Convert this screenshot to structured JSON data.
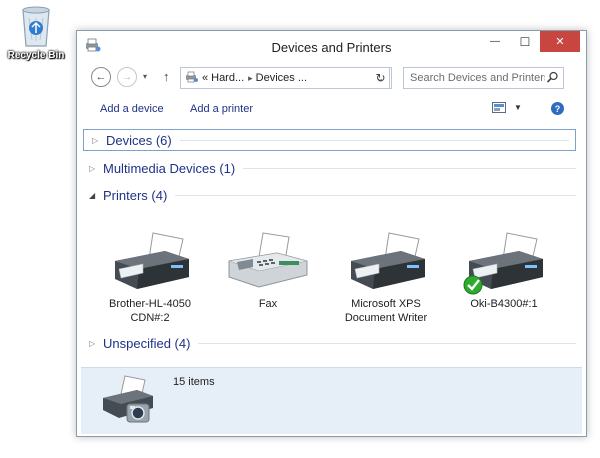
{
  "desktop": {
    "recycle_bin_label": "Recycle Bin"
  },
  "window": {
    "title": "Devices and Printers",
    "controls": {
      "minimize": "—",
      "maximize": "☐",
      "close": "✕"
    }
  },
  "nav": {
    "back": "←",
    "forward": "→",
    "recent": "▾",
    "up": "↑",
    "breadcrumb_prefix": "«",
    "breadcrumb": [
      "Hard...",
      "Devices ..."
    ],
    "separator": "▸",
    "dropdown": "⌄",
    "refresh": "↻",
    "search_placeholder": "Search Devices and Printers"
  },
  "commands": {
    "add_device": "Add a device",
    "add_printer": "Add a printer",
    "view_dropdown": "▼",
    "help": "?"
  },
  "groups": [
    {
      "label": "Devices (6)",
      "expanded": false
    },
    {
      "label": "Multimedia Devices (1)",
      "expanded": false
    },
    {
      "label": "Printers (4)",
      "expanded": true
    },
    {
      "label": "Unspecified (4)",
      "expanded": false
    }
  ],
  "printers": [
    {
      "label_line1": "Brother-HL-4050",
      "label_line2": "CDN#:2",
      "icon": "printer-icon",
      "default": false
    },
    {
      "label_line1": "Fax",
      "label_line2": "",
      "icon": "fax-icon",
      "default": false
    },
    {
      "label_line1": "Microsoft XPS",
      "label_line2": "Document Writer",
      "icon": "printer-icon",
      "default": false
    },
    {
      "label_line1": "Oki-B4300#:1",
      "label_line2": "",
      "icon": "printer-icon",
      "default": true
    }
  ],
  "details": {
    "count": "15 items"
  },
  "colors": {
    "link_blue": "#1e3287",
    "close_red": "#c7463f",
    "details_bg": "#e6eef8",
    "default_check": "#2eaa2e"
  }
}
